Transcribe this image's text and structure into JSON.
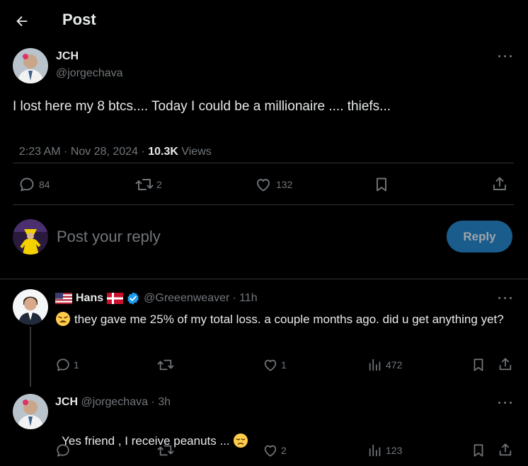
{
  "header": {
    "title": "Post"
  },
  "post": {
    "author_name": "JCH",
    "author_handle": "@jorgechava",
    "text": "I lost here my 8 btcs.... Today I could be a millionaire .... thiefs...",
    "time": "2:23 AM · Nov 28, 2024 · ",
    "views_count": "10.3K",
    "views_label": " Views",
    "replies": "84",
    "reposts": "2",
    "likes": "132"
  },
  "reply_box": {
    "placeholder": "Post your reply",
    "button_label": "Reply"
  },
  "replies": [
    {
      "name": "Hans",
      "handle": "@Greeenweaver",
      "time": "· 11h",
      "text": "they gave me 25% of my total loss.  a couple months ago. did u get anything yet?",
      "replies": "1",
      "reposts": "",
      "likes": "1",
      "views": "472",
      "emoji": "weary-face-icon"
    },
    {
      "name": "JCH",
      "handle": "@jorgechava",
      "time": "· 3h",
      "text": "Yes friend , I receive peanuts ... ",
      "replies": "",
      "reposts": "",
      "likes": "2",
      "views": "123",
      "emoji": "disappointed-face-icon"
    }
  ],
  "colors": {
    "accent": "#1d9bf0",
    "reply_button_bg": "#1a5c8c",
    "muted": "#71767b",
    "divider": "#2f3336"
  }
}
